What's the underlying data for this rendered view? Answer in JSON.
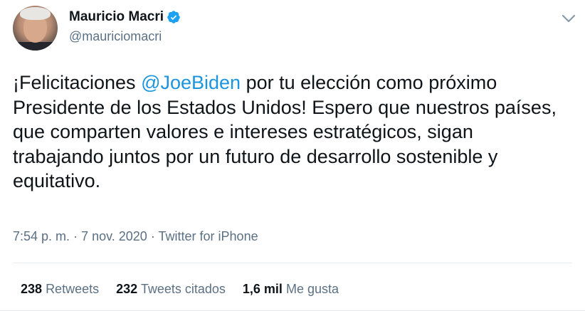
{
  "author": {
    "name": "Mauricio Macri",
    "handle": "@mauriciomacri",
    "verified": true
  },
  "tweet": {
    "text_before": "¡Felicitaciones ",
    "mention": "@JoeBiden",
    "text_after": " por tu elección como próximo Presidente de los Estados Unidos! Espero que nuestros países, que comparten valores e intereses estratégicos, sigan trabajando juntos por un futuro de desarrollo sostenible y equitativo."
  },
  "meta": {
    "time": "7:54 p. m.",
    "separator": "·",
    "date": "7 nov. 2020",
    "source": "Twitter for iPhone"
  },
  "stats": {
    "retweets_count": "238",
    "retweets_label": "Retweets",
    "quotes_count": "232",
    "quotes_label": "Tweets citados",
    "likes_count": "1,6 mil",
    "likes_label": "Me gusta"
  },
  "colors": {
    "mention": "#1b95e0",
    "verified_badge": "#1da1f2",
    "secondary_text": "#5b7083"
  },
  "icons": {
    "verified": "verified-badge-icon",
    "more": "chevron-down-icon"
  }
}
